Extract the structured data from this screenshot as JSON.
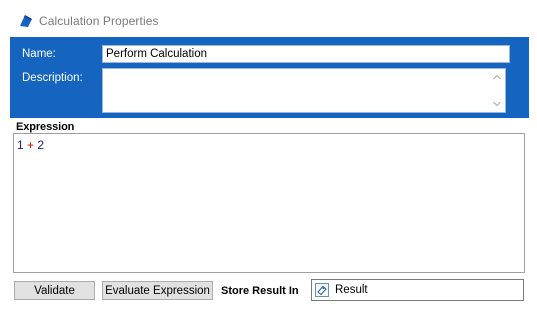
{
  "window": {
    "title": "Calculation Properties",
    "icon": "calculation-app-icon"
  },
  "header": {
    "bg_color": "#1565c0",
    "name_label": "Name:",
    "name_value": "Perform Calculation",
    "description_label": "Description:",
    "description_value": ""
  },
  "expression": {
    "label": "Expression",
    "tokens": [
      {
        "text": "1",
        "kind": "number"
      },
      {
        "text": " + ",
        "kind": "operator"
      },
      {
        "text": "2",
        "kind": "number"
      }
    ]
  },
  "actions": {
    "validate_label": "Validate",
    "evaluate_label": "Evaluate Expression",
    "store_label": "Store Result In",
    "result_value": "Result",
    "result_icon": "variable-tag-icon"
  }
}
